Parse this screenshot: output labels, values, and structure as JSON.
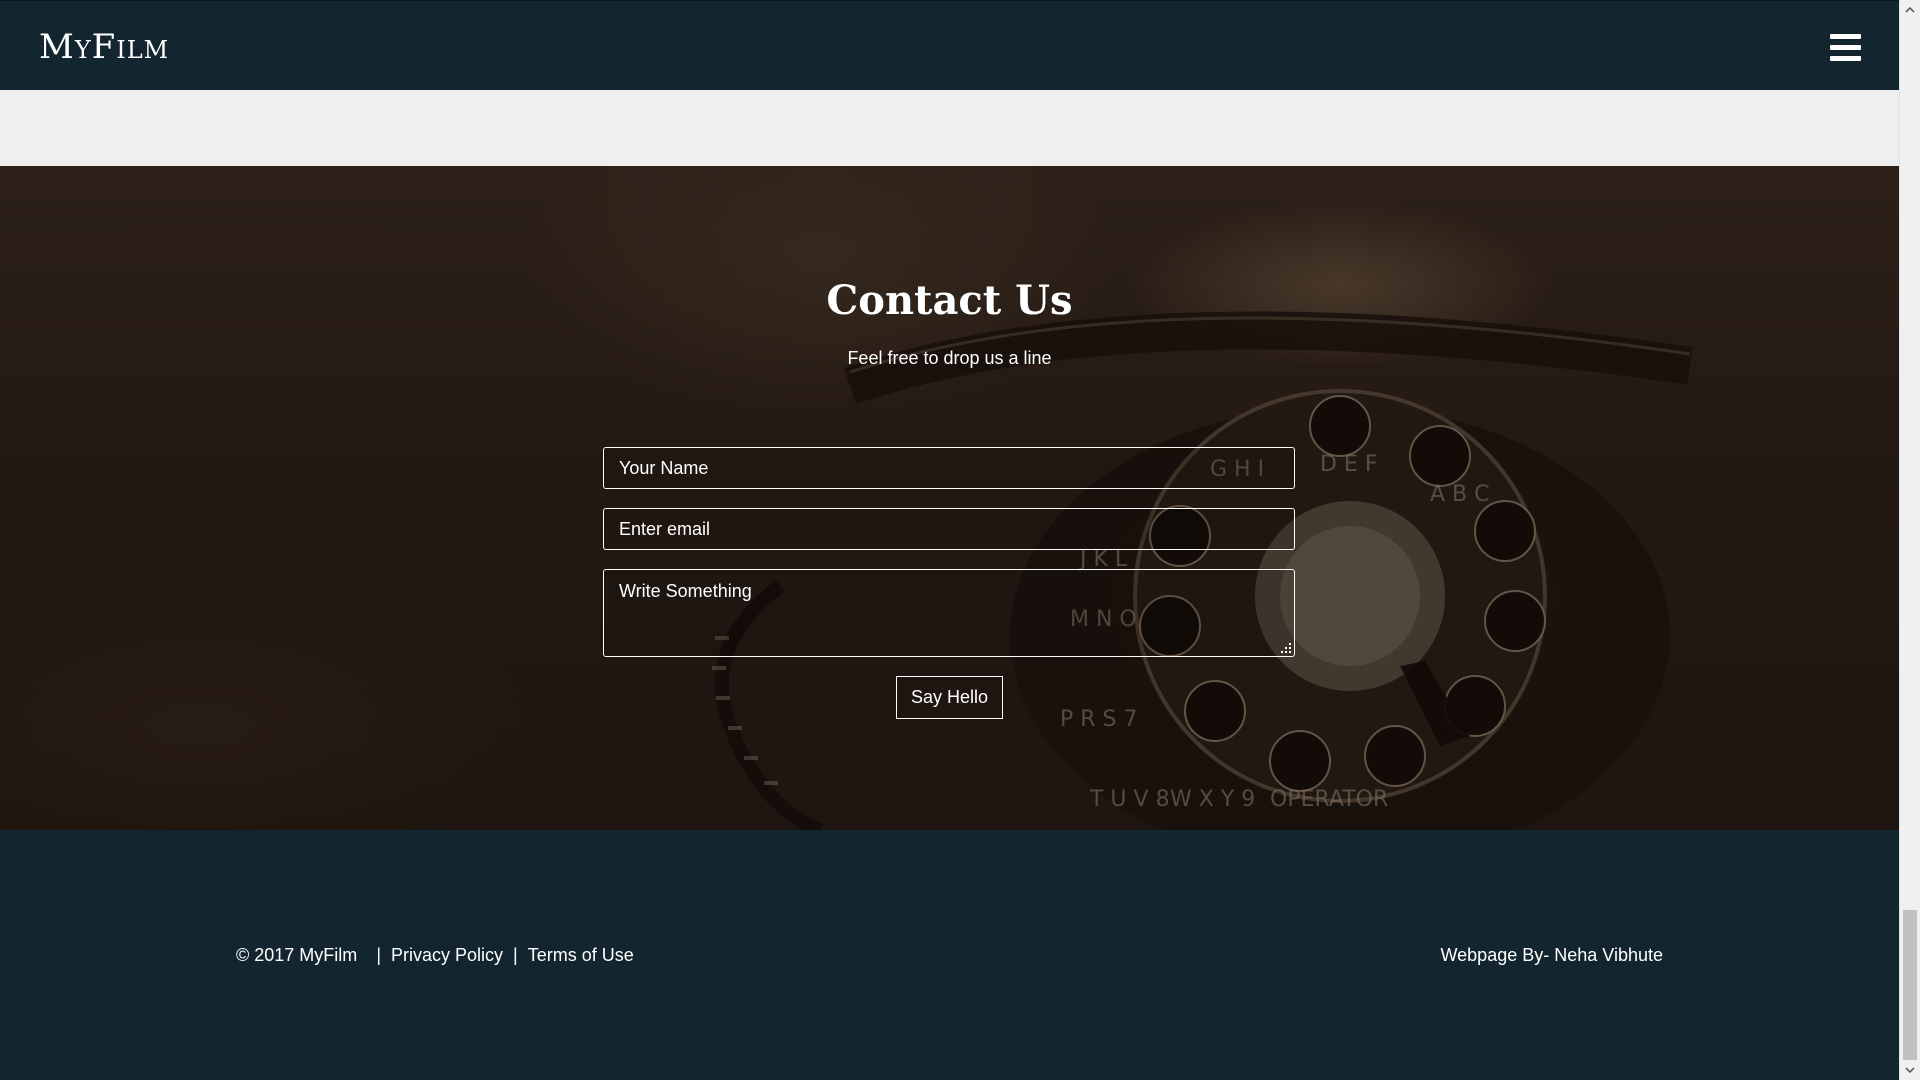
{
  "navbar": {
    "brand": "MyFilm",
    "menu_icon": "hamburger-menu-icon"
  },
  "contact": {
    "title": "Contact Us",
    "subtitle": "Feel free to drop us a line",
    "form": {
      "name_placeholder": "Your Name",
      "email_placeholder": "Enter email",
      "message_placeholder": "Write Something",
      "submit_label": "Say Hello"
    }
  },
  "footer": {
    "copyright": "© 2017 MyFilm",
    "separator": "|",
    "privacy_label": "Privacy Policy",
    "terms_label": "Terms of Use",
    "credit": "Webpage By- Neha Vibhute"
  },
  "colors": {
    "navbar_bg": "#132630",
    "footer_bg": "#132630",
    "page_bg": "#efefef",
    "text": "#ffffff"
  }
}
